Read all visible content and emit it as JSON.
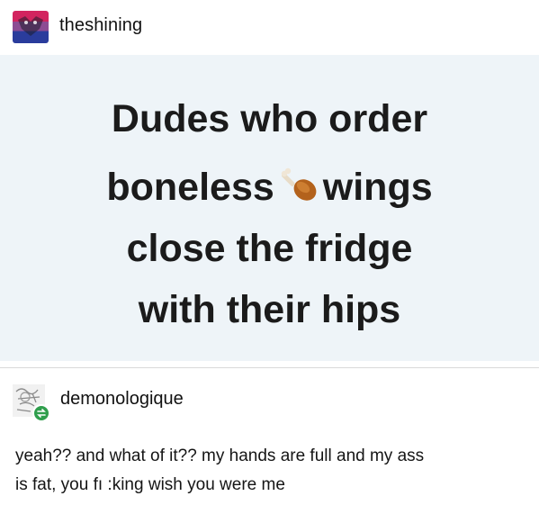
{
  "post": {
    "username": "theshining",
    "avatar_icon": "bisexual-flag-avatar-icon",
    "quote_lines": [
      "Dudes who order",
      "boneless",
      "wings",
      "close the fridge",
      "with their hips"
    ],
    "emoji_icon": "poultry-leg-icon"
  },
  "reblog": {
    "username": "demonologique",
    "avatar_icon": "sketch-avatar-icon",
    "badge_icon": "reblog-icon",
    "badge_color": "#2f9e4c",
    "text_lines": [
      "yeah?? and what of it?? my hands are full and my ass",
      "is fat, you fı :king wish you were me"
    ]
  },
  "colors": {
    "card_background": "#eef4f8",
    "text": "#1b1b1b"
  }
}
